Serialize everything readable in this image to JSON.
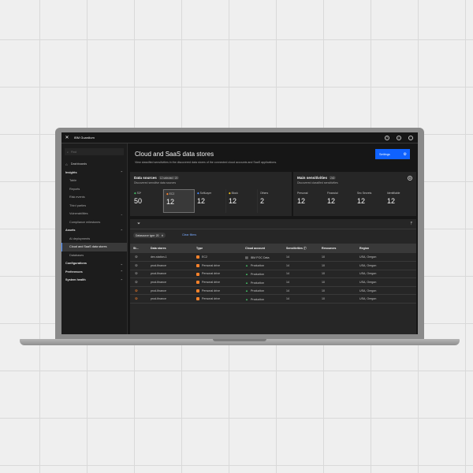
{
  "app": {
    "brand": "IBM Guardium"
  },
  "sidebar": {
    "search_placeholder": "Find",
    "items": [
      {
        "label": "Dashboards"
      },
      {
        "label": "Insights"
      },
      {
        "label": "Table"
      },
      {
        "label": "Reports"
      },
      {
        "label": "Risk events"
      },
      {
        "label": "Third parties"
      },
      {
        "label": "Vulnerabilities"
      },
      {
        "label": "Compliance milestones"
      },
      {
        "label": "Assets"
      },
      {
        "label": "AI deployments"
      },
      {
        "label": "Cloud and SaaS data stores"
      },
      {
        "label": "Databases"
      },
      {
        "label": "Configurations"
      },
      {
        "label": "Preferences"
      },
      {
        "label": "System health"
      }
    ]
  },
  "page": {
    "title": "Cloud and SaaS data stores",
    "description": "View classified sensitivities in the discovered data stores of the connected cloud accounts and SaaS applications.",
    "settings_label": "Settings"
  },
  "data_sources": {
    "title": "Data sources",
    "tag": "12 selected / 20",
    "subtitle": "Discovered sensitive data sources",
    "tiles": [
      {
        "label": "S3*",
        "value": "50",
        "icon": "s3-icon",
        "color": "#42be65"
      },
      {
        "label": "EC2",
        "value": "12",
        "icon": "ec2-icon",
        "color": "#ff832b"
      },
      {
        "label": "SoftLayer",
        "value": "12",
        "icon": "softlayer-icon",
        "color": "#4589ff"
      },
      {
        "label": "Block",
        "value": "12",
        "icon": "block-icon",
        "color": "#f1c21b"
      },
      {
        "label": "Others",
        "value": "2",
        "icon": "",
        "color": ""
      }
    ]
  },
  "main_sensitivities": {
    "title": "Main sensitivities",
    "tag": "240",
    "subtitle": "Discovered classified sensitivities",
    "tiles": [
      {
        "label": "Personal",
        "value": "12"
      },
      {
        "label": "Financial",
        "value": "12"
      },
      {
        "label": "Sec Secrets",
        "value": "12"
      },
      {
        "label": "Identifiable",
        "value": "12"
      }
    ]
  },
  "table": {
    "filter_chip": "Datasource type: 20",
    "clear_filters": "Clear filters",
    "headers": [
      "St...",
      "Data stores",
      "Type",
      "Cloud account",
      "Sensitivities",
      "Resources",
      "Region"
    ],
    "rows": [
      {
        "status": "ok",
        "store": "dev-station-1",
        "type": "EC2",
        "type_color": "#ff832b",
        "account": "IBM POC Data",
        "account_icon": "ibm-cloud-icon",
        "sens": "14",
        "res": "10",
        "region": "USA, Oregon"
      },
      {
        "status": "ok",
        "store": "prod-finance",
        "type": "Personal drive",
        "type_color": "#ff832b",
        "account": "Production",
        "account_icon": "drive-icon",
        "sens": "14",
        "res": "10",
        "region": "USA, Oregon"
      },
      {
        "status": "ok",
        "store": "prod-finance",
        "type": "Personal drive",
        "type_color": "#ff832b",
        "account": "Production",
        "account_icon": "drive-icon",
        "sens": "14",
        "res": "10",
        "region": "USA, Oregon"
      },
      {
        "status": "ok",
        "store": "prod-finance",
        "type": "Personal drive",
        "type_color": "#ff832b",
        "account": "Production",
        "account_icon": "drive-icon",
        "sens": "14",
        "res": "10",
        "region": "USA, Oregon"
      },
      {
        "status": "warn",
        "store": "prod-finance",
        "type": "Personal drive",
        "type_color": "#ff832b",
        "account": "Production",
        "account_icon": "drive-icon",
        "sens": "14",
        "res": "10",
        "region": "USA, Oregon"
      },
      {
        "status": "warn",
        "store": "prod-finance",
        "type": "Personal drive",
        "type_color": "#ff832b",
        "account": "Production",
        "account_icon": "drive-icon",
        "sens": "14",
        "res": "10",
        "region": "USA, Oregon"
      }
    ]
  }
}
